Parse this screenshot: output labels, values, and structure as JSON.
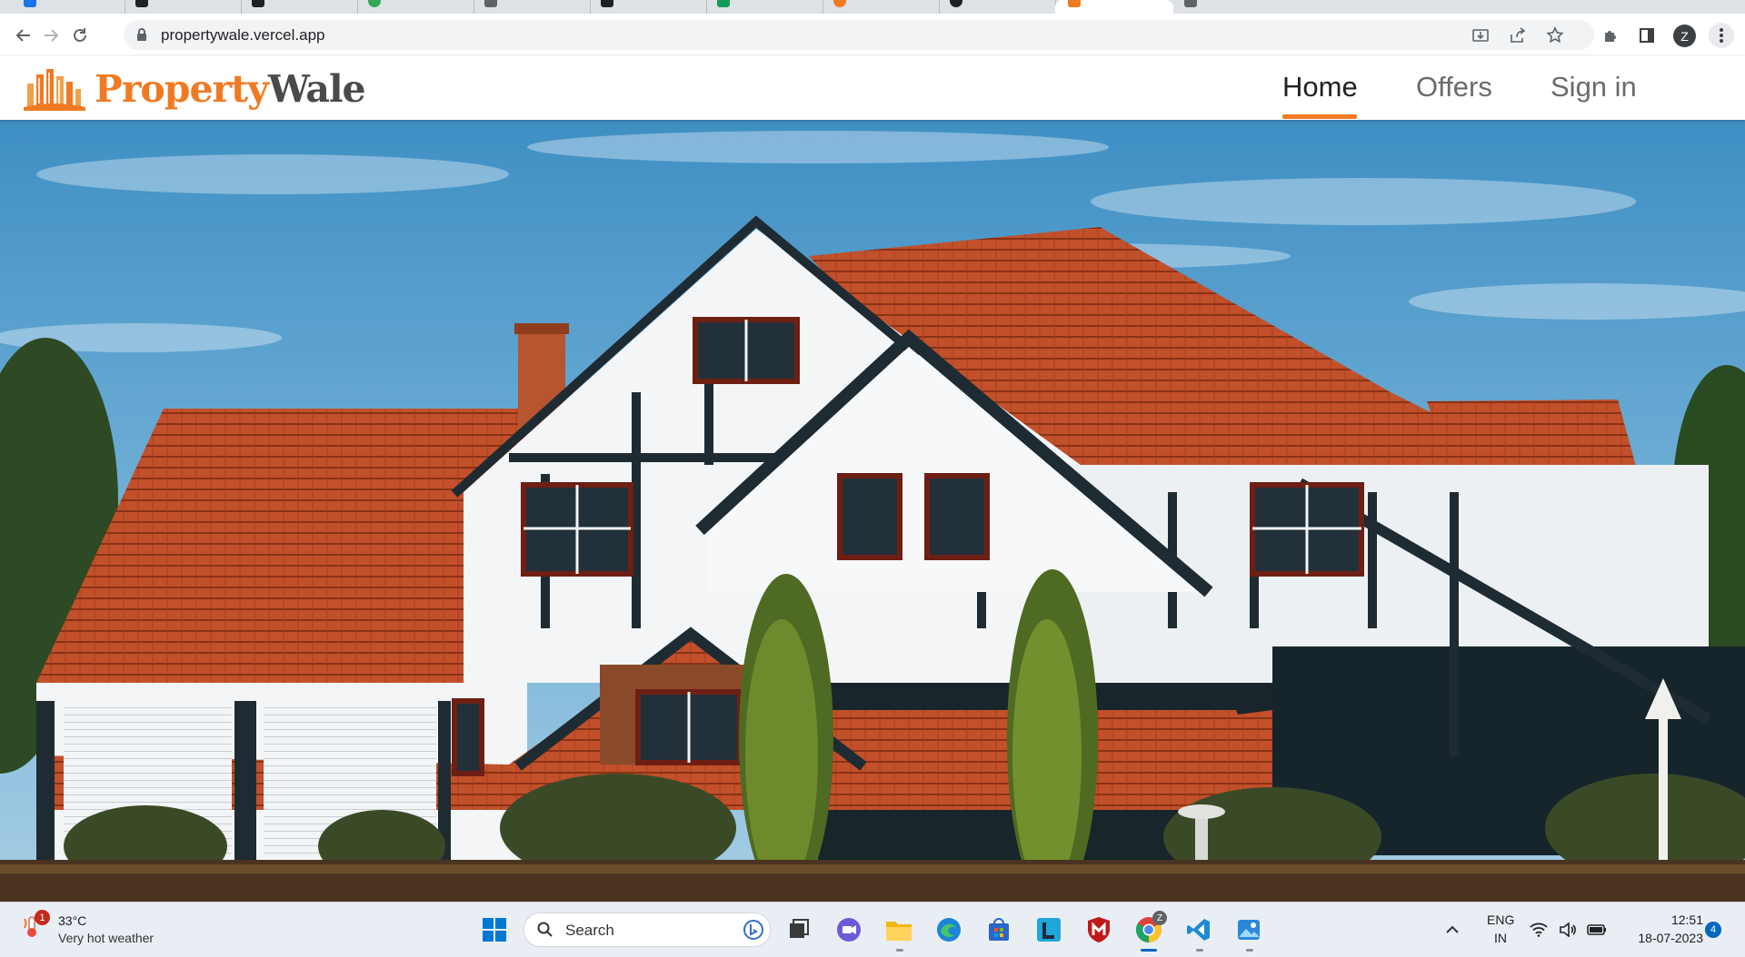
{
  "browser": {
    "url": "propertywale.vercel.app",
    "tab_colors": [
      "#1a73e8",
      "#202124",
      "#202124",
      "#34a853",
      "#5f6368",
      "#202124",
      "#0f9d58",
      "#f07a22",
      "#202124",
      "#f07a22",
      "#5f6368"
    ]
  },
  "site": {
    "brand_part1": "Property",
    "brand_part2": "Wale",
    "brand_color": "#f07a22",
    "nav": {
      "home": "Home",
      "offers": "Offers",
      "sign_in": "Sign in"
    },
    "hero_icon": "tudor-house-photo"
  },
  "taskbar": {
    "weather_temp": "33°C",
    "weather_desc": "Very hot weather",
    "weather_badge": "1",
    "search_label": "Search",
    "lang_line1": "ENG",
    "lang_line2": "IN",
    "time": "12:51",
    "date": "18-07-2023",
    "notification_count": "4",
    "chrome_badge": "Z",
    "apps": [
      "start",
      "search",
      "task-view",
      "meet",
      "file-explorer",
      "edge",
      "store",
      "linkedin-learning",
      "mcafee",
      "chrome",
      "vscode",
      "photos"
    ]
  },
  "profile_initial": "Z"
}
